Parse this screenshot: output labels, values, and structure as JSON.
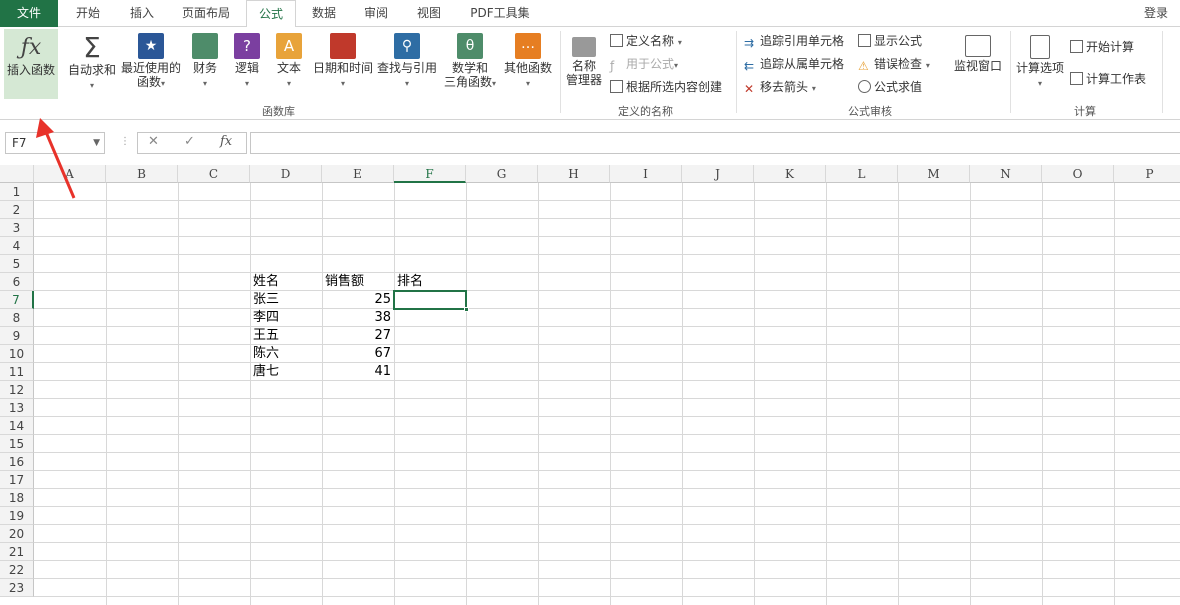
{
  "tabs": [
    "文件",
    "开始",
    "插入",
    "页面布局",
    "公式",
    "数据",
    "审阅",
    "视图",
    "PDF工具集"
  ],
  "login": "登录",
  "ribbon": {
    "insert_fn": "插入函数",
    "autosum": "自动求和",
    "recent1": "最近使用的",
    "recent2": "函数",
    "finance": "财务",
    "logic": "逻辑",
    "text": "文本",
    "datetime": "日期和时间",
    "lookup": "查找与引用",
    "math1": "数学和",
    "math2": "三角函数",
    "other": "其他函数",
    "group_lib": "函数库",
    "name_mgr1": "名称",
    "name_mgr2": "管理器",
    "define_name": "定义名称",
    "use_in_formula": "用于公式",
    "create_from_sel": "根据所选内容创建",
    "group_names": "定义的名称",
    "trace_prec": "追踪引用单元格",
    "trace_dep": "追踪从属单元格",
    "remove_arrows": "移去箭头",
    "show_formulas": "显示公式",
    "error_check": "错误检查",
    "eval_formula": "公式求值",
    "watch_window": "监视窗口",
    "group_audit": "公式审核",
    "calc_options": "计算选项",
    "calc_now": "开始计算",
    "calc_sheet": "计算工作表",
    "group_calc": "计算"
  },
  "formula_bar": {
    "name_box": "F7",
    "cancel": "✕",
    "enter": "✓",
    "fx": "fx",
    "content": ""
  },
  "sheet": {
    "columns": [
      "A",
      "B",
      "C",
      "D",
      "E",
      "F",
      "G",
      "H",
      "I",
      "J",
      "K",
      "L",
      "M",
      "N",
      "O",
      "P"
    ],
    "rows": [
      "1",
      "2",
      "3",
      "4",
      "5",
      "6",
      "7",
      "8",
      "9",
      "10",
      "11",
      "12",
      "13",
      "14",
      "15",
      "16",
      "17",
      "18",
      "19",
      "20",
      "21",
      "22",
      "23"
    ],
    "header": {
      "name": "姓名",
      "sales": "销售额",
      "rank": "排名"
    },
    "records": [
      {
        "name": "张三",
        "sales": "25"
      },
      {
        "name": "李四",
        "sales": "38"
      },
      {
        "name": "王五",
        "sales": "27"
      },
      {
        "name": "陈六",
        "sales": "67"
      },
      {
        "name": "唐七",
        "sales": "41"
      }
    ]
  },
  "colors": {
    "accent": "#217346",
    "arrow": "#e8322a"
  }
}
